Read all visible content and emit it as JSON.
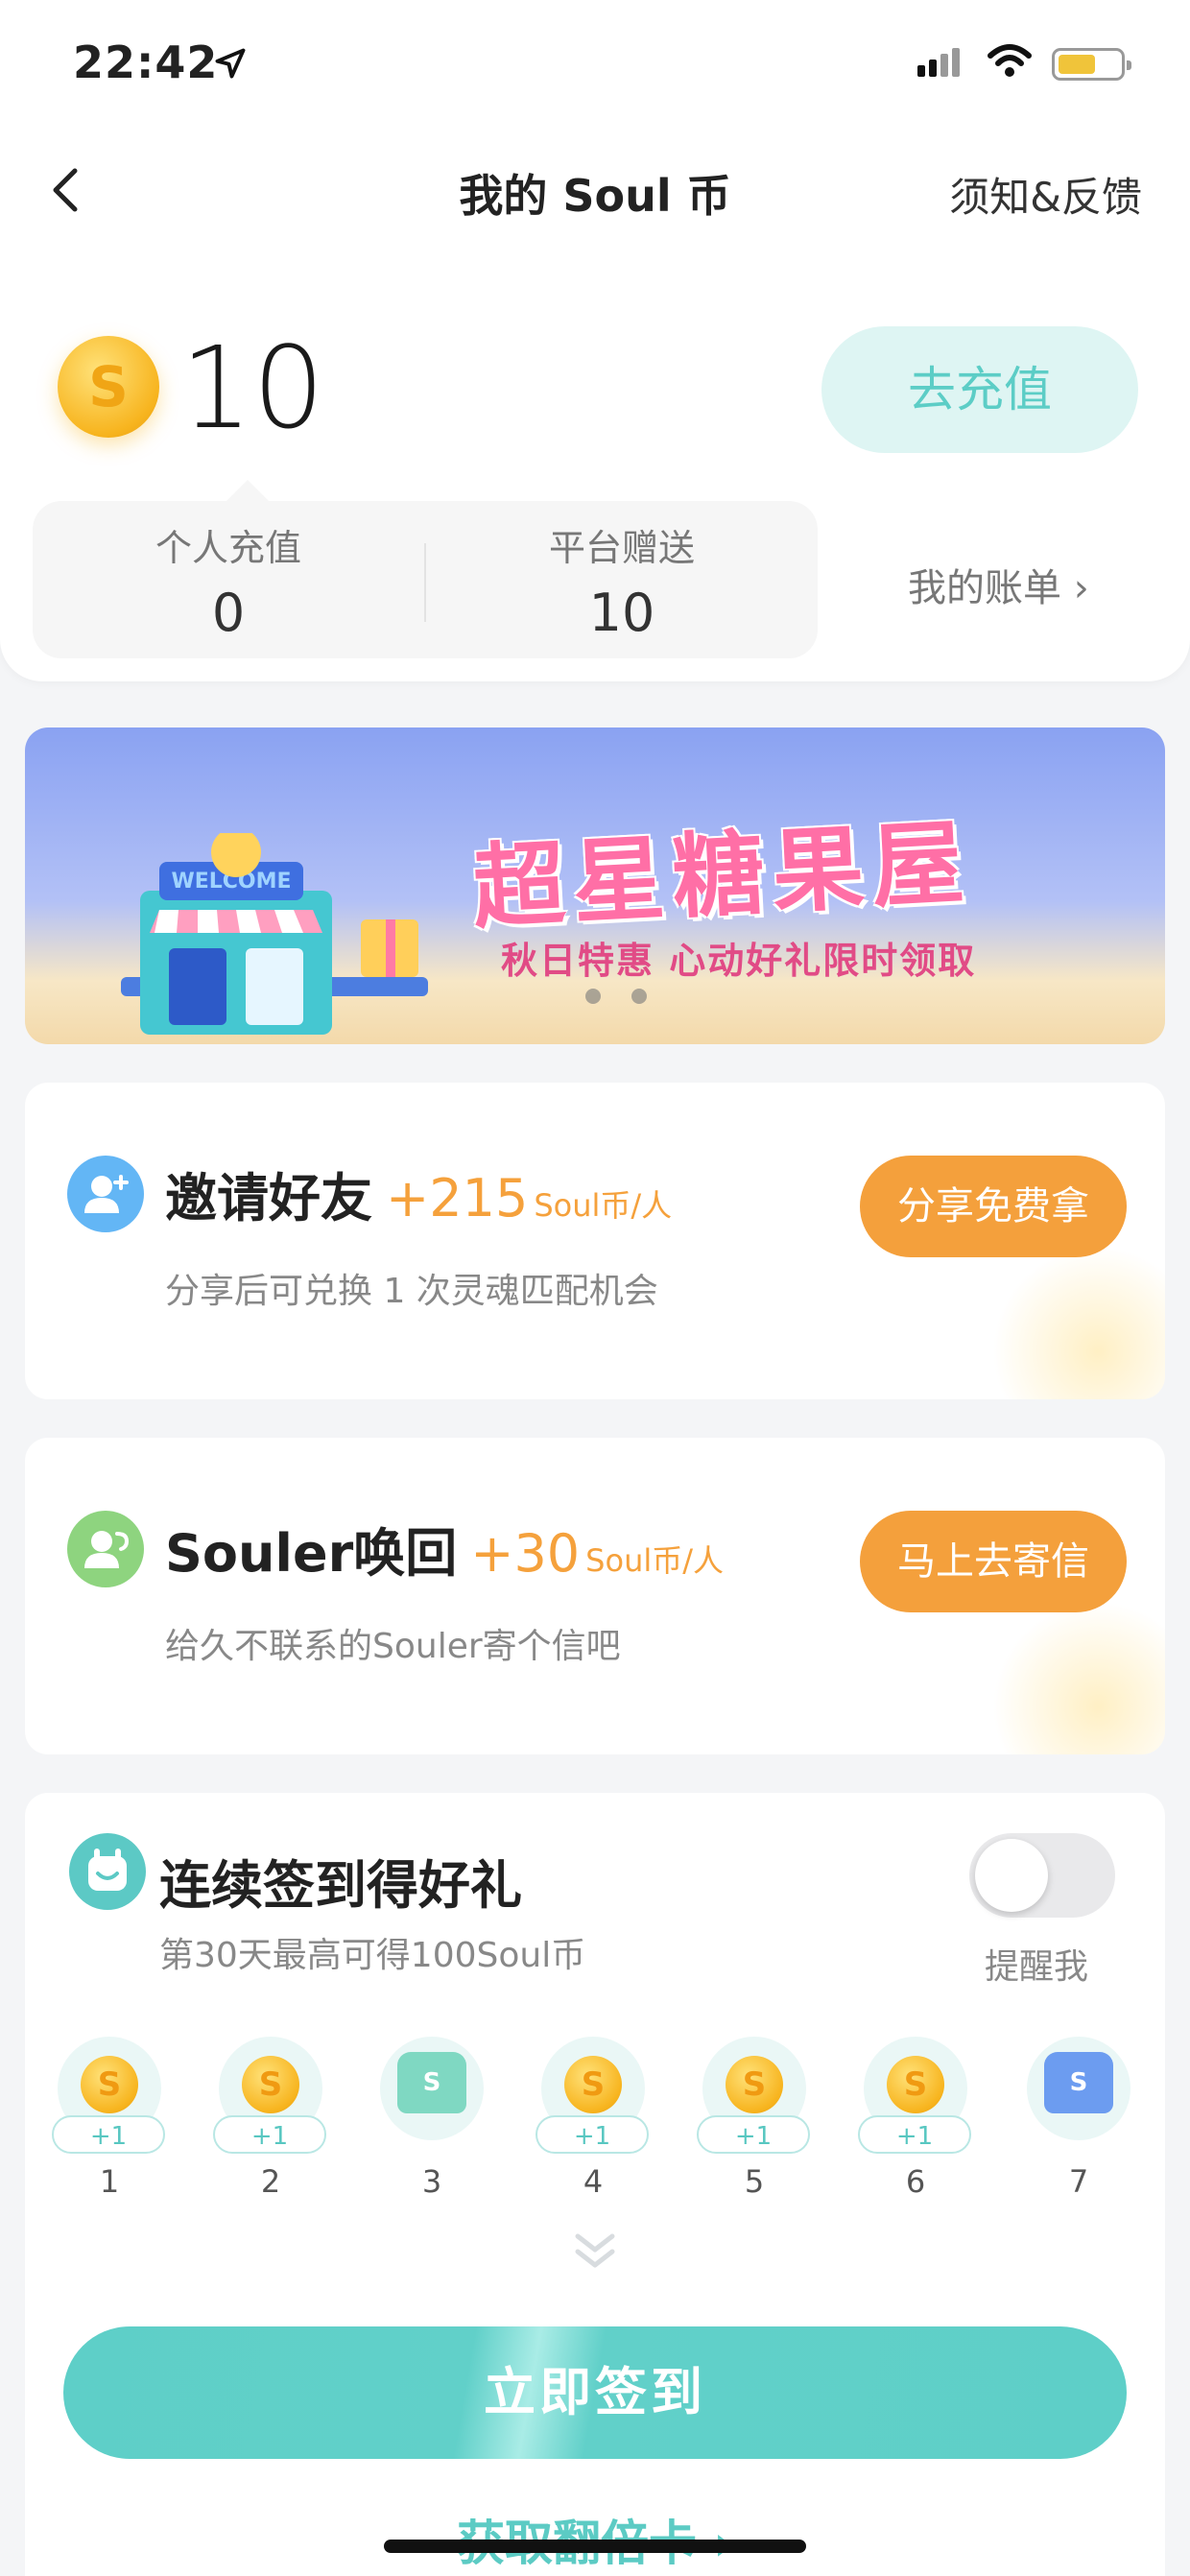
{
  "status_bar": {
    "time": "22:42"
  },
  "nav": {
    "title": "我的 Soul 币",
    "right_link": "须知&反馈"
  },
  "balance": {
    "coin_symbol": "S",
    "amount": "10",
    "recharge_button": "去充值",
    "personal_label": "个人充值",
    "personal_value": "0",
    "platform_label": "平台赠送",
    "platform_value": "10",
    "bill_link": "我的账单 ›"
  },
  "banner": {
    "title": "超星糖果屋",
    "subtitle": "秋日特惠 心动好礼限时领取",
    "sign_text": "WELCOME"
  },
  "tasks": [
    {
      "title": "邀请好友",
      "amount": "+215",
      "unit": "Soul币/人",
      "desc": "分享后可兑换 1 次灵魂匹配机会",
      "button": "分享免费拿"
    },
    {
      "title": "Souler唤回",
      "amount": "+30",
      "unit": "Soul币/人",
      "desc": "给久不联系的Souler寄个信吧",
      "button": "马上去寄信"
    }
  ],
  "checkin": {
    "title": "连续签到得好礼",
    "subtitle": "第30天最高可得100Soul币",
    "remind_label": "提醒我",
    "remind_on": false,
    "days": [
      {
        "num": "1",
        "reward": "+1",
        "kind": "coin"
      },
      {
        "num": "2",
        "reward": "+1",
        "kind": "coin"
      },
      {
        "num": "3",
        "reward": "",
        "kind": "chest-green"
      },
      {
        "num": "4",
        "reward": "+1",
        "kind": "coin"
      },
      {
        "num": "5",
        "reward": "+1",
        "kind": "coin"
      },
      {
        "num": "6",
        "reward": "+1",
        "kind": "coin"
      },
      {
        "num": "7",
        "reward": "",
        "kind": "chest-blue"
      }
    ],
    "sign_button": "立即签到",
    "double_link": "获取翻倍卡 ›"
  },
  "colors": {
    "accent_teal": "#5ecfc8",
    "accent_orange": "#f4a03c",
    "coin_gold": "#f7b41e",
    "banner_pink": "#ff6fa6"
  }
}
